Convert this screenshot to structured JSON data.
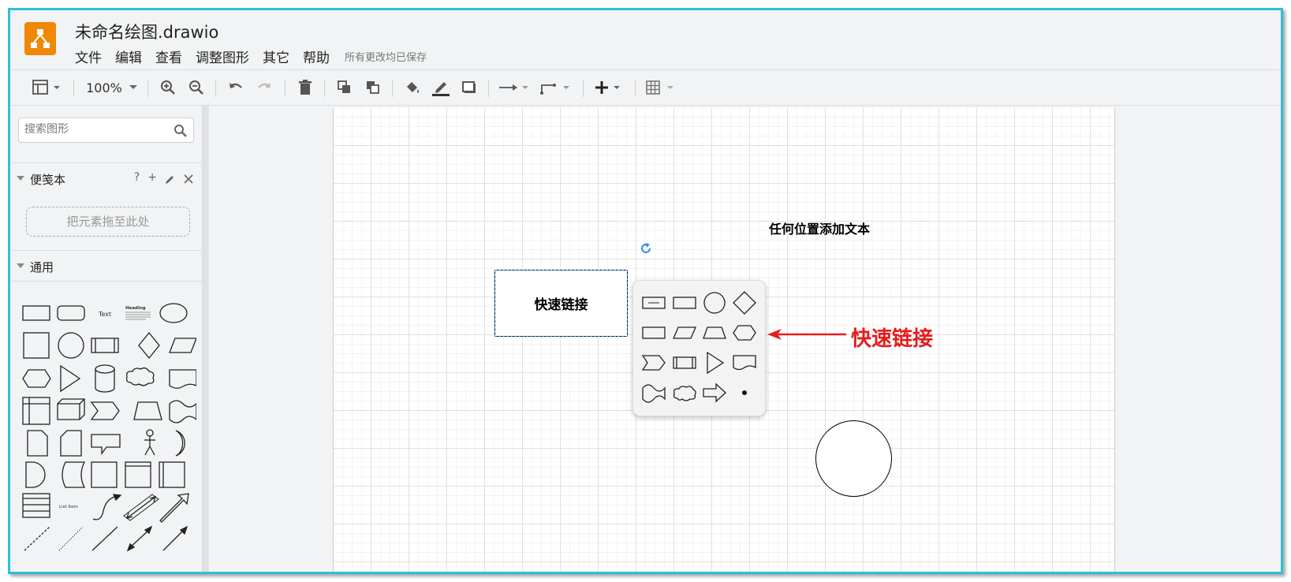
{
  "app": {
    "document_title": "未命名绘图.drawio",
    "menu": [
      "文件",
      "编辑",
      "查看",
      "调整图形",
      "其它",
      "帮助"
    ],
    "save_status": "所有更改均已保存",
    "brand_color": "#f08705"
  },
  "toolbar": {
    "zoom": "100%"
  },
  "sidebar": {
    "search_placeholder": "搜索图形",
    "scratchpad": {
      "title": "便笺本",
      "help": "?",
      "add": "+",
      "dropzone": "把元素拖至此处"
    },
    "general": {
      "title": "通用",
      "text_shape_label": "Text",
      "heading_shape_label": "Heading",
      "list_item_label": "List Item"
    }
  },
  "canvas": {
    "box_label": "快速链接",
    "free_text": "任何位置添加文本",
    "annotation_label": "快速链接",
    "annotation_color": "#e41c1c",
    "selection_color": "#2d8eea"
  }
}
